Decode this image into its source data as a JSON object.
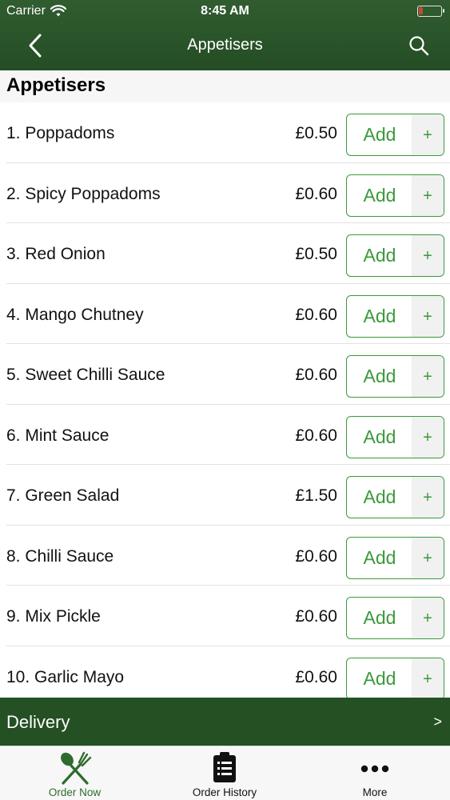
{
  "status_bar": {
    "carrier": "Carrier",
    "time": "8:45 AM"
  },
  "nav": {
    "title": "Appetisers",
    "back_icon": "chevron-left-icon",
    "search_icon": "search-icon"
  },
  "section": {
    "title": "Appetisers"
  },
  "items": [
    {
      "name": "1. Poppadoms",
      "price": "£0.50",
      "add": "Add",
      "plus": "+"
    },
    {
      "name": "2. Spicy Poppadoms",
      "price": "£0.60",
      "add": "Add",
      "plus": "+"
    },
    {
      "name": "3. Red Onion",
      "price": "£0.50",
      "add": "Add",
      "plus": "+"
    },
    {
      "name": "4. Mango Chutney",
      "price": "£0.60",
      "add": "Add",
      "plus": "+"
    },
    {
      "name": "5. Sweet Chilli Sauce",
      "price": "£0.60",
      "add": "Add",
      "plus": "+"
    },
    {
      "name": "6. Mint Sauce",
      "price": "£0.60",
      "add": "Add",
      "plus": "+"
    },
    {
      "name": "7. Green Salad",
      "price": "£1.50",
      "add": "Add",
      "plus": "+"
    },
    {
      "name": "8. Chilli Sauce",
      "price": "£0.60",
      "add": "Add",
      "plus": "+"
    },
    {
      "name": "9. Mix Pickle",
      "price": "£0.60",
      "add": "Add",
      "plus": "+"
    },
    {
      "name": "10. Garlic Mayo",
      "price": "£0.60",
      "add": "Add",
      "plus": "+"
    }
  ],
  "delivery": {
    "label": "Delivery",
    "arrow": ">"
  },
  "tabs": [
    {
      "label": "Order Now",
      "icon": "fork-spoon-icon",
      "active": true
    },
    {
      "label": "Order History",
      "icon": "clipboard-list-icon",
      "active": false
    },
    {
      "label": "More",
      "icon": "more-dots-icon",
      "active": false
    }
  ],
  "colors": {
    "header": "#2b5a2b",
    "accent": "#3a9a3a",
    "active_tab": "#2e6b2e"
  }
}
